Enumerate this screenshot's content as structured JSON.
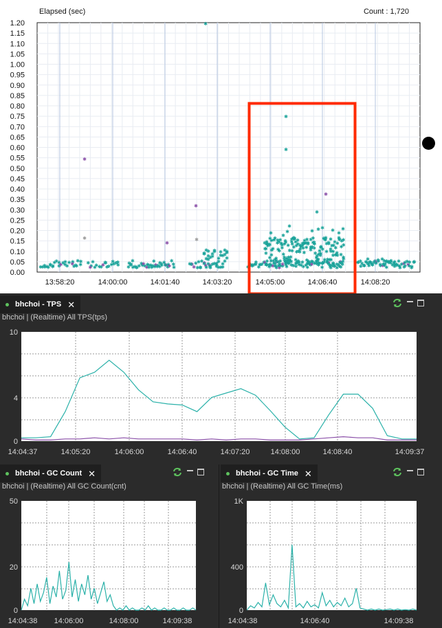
{
  "xlog": {
    "ylabel": "Elapsed (sec)",
    "count_label": "Count : 1,720",
    "yticks": [
      "1.20",
      "1.15",
      "1.10",
      "1.05",
      "1.00",
      "0.95",
      "0.90",
      "0.85",
      "0.80",
      "0.75",
      "0.70",
      "0.65",
      "0.60",
      "0.55",
      "0.50",
      "0.45",
      "0.40",
      "0.35",
      "0.30",
      "0.25",
      "0.20",
      "0.15",
      "0.10",
      "0.05",
      "0.00"
    ],
    "xticks": [
      "13:58:20",
      "14:00:00",
      "14:01:40",
      "14:03:20",
      "14:05:00",
      "14:06:40",
      "14:08:20"
    ],
    "highlight_color": "#ff2a00",
    "point_color": "#1aa39a",
    "outlier_color": "#8a4fa8"
  },
  "chart_data": [
    {
      "type": "scatter",
      "title": "",
      "xlabel": "",
      "ylabel": "Elapsed (sec)",
      "ylim": [
        0,
        1.2
      ],
      "x_range": [
        "13:57:40",
        "14:09:40"
      ],
      "series": [
        {
          "values_note": "",
          "x": [
            "14:03:10",
            "14:05:40",
            "14:05:40",
            "14:06:50",
            "14:06:40",
            "13:59:10",
            "14:02:40",
            "14:01:10",
            "13:59:10",
            "14:02:40"
          ],
          "y": [
            1.19,
            0.74,
            0.58,
            0.37,
            0.29,
            0.54,
            0.31,
            0.14,
            0.16,
            0.15
          ]
        }
      ]
    },
    {
      "type": "line",
      "title": "bhchoi - TPS",
      "ylim": [
        0,
        10
      ],
      "yticks": [
        "10",
        "4",
        "0"
      ],
      "x": [
        "14:04:37",
        "14:05:20",
        "14:06:00",
        "14:06:40",
        "14:07:20",
        "14:08:00",
        "14:08:40",
        "14:09:37"
      ],
      "series": [
        {
          "values": [
            0.3,
            0.3,
            0.4,
            2.7,
            5.8,
            6.3,
            7.4,
            6.3,
            4.7,
            3.6,
            3.4,
            3.3,
            2.7,
            4.0,
            4.4,
            4.8,
            4.2,
            2.8,
            1.3,
            0.2,
            0.3,
            2.4,
            4.3,
            4.3,
            3.0,
            0.5,
            0.2,
            0.2
          ]
        },
        {
          "values": [
            0.2,
            0.1,
            0.1,
            0.2,
            0.2,
            0.3,
            0.2,
            0.3,
            0.2,
            0.2,
            0.2,
            0.2,
            0.1,
            0.2,
            0.1,
            0.2,
            0.2,
            0.1,
            0.1,
            0.1,
            0.2,
            0.3,
            0.4,
            0.3,
            0.3,
            0.1,
            0.1,
            0.1
          ]
        }
      ]
    },
    {
      "type": "line",
      "title": "bhchoi - GC Count",
      "ylim": [
        0,
        50
      ],
      "yticks": [
        "50",
        "20",
        "0"
      ],
      "x": [
        "14:04:38",
        "14:06:00",
        "14:08:00",
        "14:09:38"
      ],
      "series": [
        {
          "values": [
            0,
            5,
            2,
            10,
            3,
            12,
            4,
            8,
            15,
            3,
            11,
            6,
            18,
            5,
            9,
            22,
            6,
            14,
            4,
            12,
            7,
            16,
            5,
            10,
            3,
            8,
            13,
            4,
            7,
            2,
            0,
            1,
            0,
            2,
            0,
            1,
            0,
            0,
            1,
            0,
            2,
            0,
            1,
            0,
            0,
            1,
            0,
            0,
            1,
            0,
            0,
            1,
            0,
            0,
            1,
            0
          ]
        }
      ]
    },
    {
      "type": "line",
      "title": "bhchoi - GC Time",
      "ylim": [
        0,
        1000
      ],
      "yticks": [
        "1K",
        "400",
        "0"
      ],
      "x": [
        "14:04:38",
        "14:06:40",
        "14:09:38"
      ],
      "series": [
        {
          "values": [
            0,
            40,
            20,
            70,
            30,
            250,
            50,
            140,
            60,
            30,
            90,
            20,
            600,
            30,
            60,
            20,
            80,
            30,
            50,
            20,
            160,
            40,
            90,
            30,
            70,
            40,
            110,
            30,
            60,
            200,
            20,
            10,
            0,
            10,
            0,
            10,
            0,
            5,
            10,
            0,
            10,
            0,
            5,
            0,
            10,
            0
          ]
        }
      ]
    }
  ],
  "tps": {
    "tab_label": "bhchoi - TPS",
    "subtitle": "bhchoi | (Realtime) All TPS(tps)",
    "yticks": [
      "10",
      "4",
      "0"
    ],
    "xticks": [
      "14:04:37",
      "14:05:20",
      "14:06:00",
      "14:06:40",
      "14:07:20",
      "14:08:00",
      "14:08:40",
      "14:09:37"
    ]
  },
  "gc_count": {
    "tab_label": "bhchoi - GC Count",
    "subtitle": "bhchoi | (Realtime) All GC Count(cnt)",
    "yticks": [
      "50",
      "20",
      "0"
    ],
    "xticks": [
      "14:04:38",
      "14:06:00",
      "14:08:00",
      "14:09:38"
    ]
  },
  "gc_time": {
    "tab_label": "bhchoi - GC Time",
    "subtitle": "bhchoi | (Realtime) All GC Time(ms)",
    "yticks": [
      "1K",
      "400",
      "0"
    ],
    "xticks": [
      "14:04:38",
      "14:06:40",
      "14:09:38"
    ]
  },
  "icons": {
    "refresh": "refresh-icon",
    "minimize": "minimize-icon",
    "maximize": "maximize-icon",
    "close": "close-icon"
  }
}
